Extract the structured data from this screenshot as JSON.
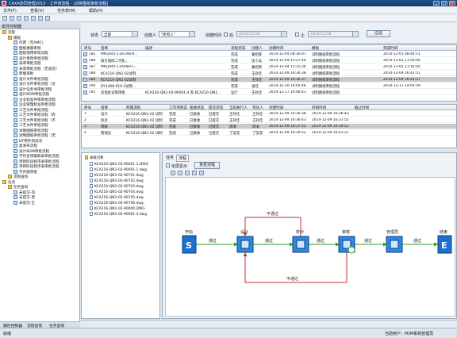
{
  "window": {
    "title": "CAXA协同管理2013 - 工作流流程 - [试制图纸审批流程]",
    "min": "_",
    "max": "□",
    "close": "×"
  },
  "menu": [
    "文件(F)",
    "查看(V)",
    "任务表(M)",
    "帮助(H)"
  ],
  "left_panel": {
    "header": "属性控制器",
    "tree": [
      {
        "label": "流程",
        "indent": 0,
        "icon": "folder"
      },
      {
        "label": "模板",
        "indent": 1,
        "icon": "folder"
      },
      {
        "label": "作废（无AMC）",
        "indent": 2,
        "icon": "doc"
      },
      {
        "label": "图纸换版审批",
        "indent": 2,
        "icon": "doc"
      },
      {
        "label": "图纸借用审批流程",
        "indent": 2,
        "icon": "doc"
      },
      {
        "label": "设计更改审批流程",
        "indent": 2,
        "icon": "doc"
      },
      {
        "label": "表单审批流程",
        "indent": 2,
        "icon": "doc"
      },
      {
        "label": "表单审批流程（无会签）",
        "indent": 2,
        "icon": "doc"
      },
      {
        "label": "新版审批",
        "indent": 2,
        "icon": "doc"
      },
      {
        "label": "设计文件审批流程",
        "indent": 2,
        "icon": "doc"
      },
      {
        "label": "设计文件审批流程（文",
        "indent": 2,
        "icon": "doc"
      },
      {
        "label": "设计任务书审批流程",
        "indent": 2,
        "icon": "doc"
      },
      {
        "label": "设计BOM审批流程",
        "indent": 2,
        "icon": "doc"
      },
      {
        "label": "企业标准件库审批流程",
        "indent": 2,
        "icon": "doc"
      },
      {
        "label": "企业管理标准审批流程",
        "indent": 2,
        "icon": "doc"
      },
      {
        "label": "工艺文件审批流程",
        "indent": 2,
        "icon": "doc"
      },
      {
        "label": "工艺文件审批流程（有",
        "indent": 2,
        "icon": "doc"
      },
      {
        "label": "工艺文件审批流程（不",
        "indent": 2,
        "icon": "doc"
      },
      {
        "label": "工艺文件审批流程",
        "indent": 2,
        "icon": "doc"
      },
      {
        "label": "试制图纸审批流程",
        "indent": 2,
        "icon": "doc"
      },
      {
        "label": "试制图纸审批流程（无",
        "indent": 2,
        "icon": "doc"
      },
      {
        "label": "DY零件测试流",
        "indent": 2,
        "icon": "doc"
      },
      {
        "label": "复发布流程",
        "indent": 2,
        "icon": "doc"
      },
      {
        "label": "设计BOM审批流程",
        "indent": 2,
        "icon": "doc"
      },
      {
        "label": "不符合项跟踪表审批流程",
        "indent": 2,
        "icon": "doc"
      },
      {
        "label": "项目阶段程序表审批流程",
        "indent": 2,
        "icon": "doc"
      },
      {
        "label": "项目阶段程序表审批流程",
        "indent": 2,
        "icon": "doc"
      },
      {
        "label": "不升版审批",
        "indent": 2,
        "icon": "doc"
      },
      {
        "label": "流程查询",
        "indent": 1,
        "icon": "folder"
      },
      {
        "label": "任务",
        "indent": 0,
        "icon": "folder"
      },
      {
        "label": "任务查询",
        "indent": 1,
        "icon": "folder"
      },
      {
        "label": "未提交-刘",
        "indent": 2,
        "icon": "doc"
      },
      {
        "label": "未提交-曾",
        "indent": 2,
        "icon": "doc"
      },
      {
        "label": "未提交-王",
        "indent": 2,
        "icon": "doc"
      }
    ],
    "tabs": [
      "属性控制器",
      "流程查询",
      "任务查询"
    ]
  },
  "filter": {
    "status_label": "状态",
    "status_value": "全部",
    "creator_label": "创建人",
    "creator_value": "\"所有人\"",
    "time_label": "创建时间",
    "after_label": "后",
    "date_from": "2014/12/18",
    "before_label": "止",
    "date_to": "2014/12/18",
    "filter_button": "过滤"
  },
  "process_table": {
    "headers": [
      "序号",
      "名称",
      "描述",
      "流程状态",
      "创建人",
      "创建时间",
      "模板",
      "完成时间"
    ],
    "rows": [
      [
        "185",
        "MKQ445-110CAN-9...",
        "",
        "完成",
        "秦绍辉",
        "2014-12-04 08:36:07",
        "试制图纸审批流程",
        "2014-12-05 08:44:51"
      ],
      [
        "186",
        "四方城阳二代机...",
        "",
        "完成",
        "沈小兵",
        "2014-12-04 13:27:46",
        "试制图纸审批流程",
        "2014-12-05 11:56:06"
      ],
      [
        "187",
        "MKQ445-110END-C...",
        "",
        "完成",
        "秦绍辉",
        "2014-12-04 15:15:36",
        "试制图纸审批流程",
        "2014-12-05 11:16:50"
      ],
      [
        "188",
        "KCA216-QN1-02试制",
        "",
        "完成",
        "王祥佳",
        "2014-12-09 16:36:38",
        "试制图纸审批流程",
        "2014-12-09 16:42:51"
      ],
      [
        "189",
        "KCA216-QN1-02试制",
        "",
        "完成",
        "王祥佳",
        "2014-12-09 16:36:37",
        "试制图纸审批流程",
        "2014-12-09 16:43:37"
      ],
      [
        "190",
        "DY1408-010-3试制...",
        "",
        "完成",
        "张佳",
        "2014-12-10 14:05:46",
        "试制图纸审批流程",
        "2014-12-11 14:05:59"
      ],
      [
        "191",
        "充电桩试制审批",
        "KCA216-QN1-02-90001-4 及 KCA216-QN1...",
        "运行",
        "王祥佳",
        "2014-12-17 16:46:43",
        "试制图纸审批流程",
        ""
      ]
    ],
    "selected_index": 4
  },
  "task_table": {
    "headers": [
      "序号",
      "名称",
      "所属流程",
      "工作项状态",
      "接收状态",
      "提交状态",
      "当前执行人",
      "责任人",
      "创建时间",
      "开始时间",
      "截止时间"
    ],
    "rows": [
      [
        "1",
        "设计",
        "KCA216-QN1-02 试制",
        "完成",
        "已接收",
        "已提交",
        "王祥佳",
        "王祥佳",
        "2014-12-09 16:36:38",
        "2014-12-09 16:36:43",
        ""
      ],
      [
        "2",
        "校对",
        "KCA216-QN1-02 试制",
        "完成",
        "已接收",
        "已提交",
        "王祥佳",
        "王祥佳",
        "2014-12-09 16:36:43",
        "2014-12-09 16:37:55",
        ""
      ],
      [
        "3",
        "审核",
        "KCA216-QN1-02 试制",
        "完成",
        "已接收",
        "已提交",
        "周涛",
        "周涛",
        "2014-12-09 16:37:55",
        "2014-12-09 16:39:52",
        ""
      ],
      [
        "4",
        "管理员",
        "KCA216-QN1-02 试制",
        "完成",
        "已接收",
        "已提交",
        "丁莹莹",
        "丁莹莹",
        "2014-12-09 16:39:52",
        "2014-12-09 16:41:37",
        ""
      ]
    ],
    "selected_index": 2
  },
  "objects": {
    "root": "关联对象",
    "items": [
      "KCA216-QN1-02-90001-1.DWG",
      "KCA216-QN1-02-90001-1.dwg",
      "KCA216-QN1-02-90701.dwg",
      "KCA216-QN1-02-90702.dwg",
      "KCA216-QN1-02-90703.dwg",
      "KCA216-QN1-02-90704.dwg",
      "KCA216-QN1-02-90705.dwg",
      "KCA216-QN1-02-90706.dwg",
      "KCA216-QN1-02-90000.DWG",
      "KCA216-QN1-02-90001-3.dwg"
    ]
  },
  "flow": {
    "tabs": [
      "任务",
      "流程"
    ],
    "show_all_label": "全屏显示",
    "change_flow_button": "变更流程",
    "nodes": [
      "开始",
      "设计",
      "校对",
      "审核",
      "管理员",
      "结束"
    ],
    "edge_pass": "通过",
    "edge_fail": "不通过"
  },
  "status": {
    "left": "就绪",
    "right": "当前用户：PDM系统管理员"
  }
}
